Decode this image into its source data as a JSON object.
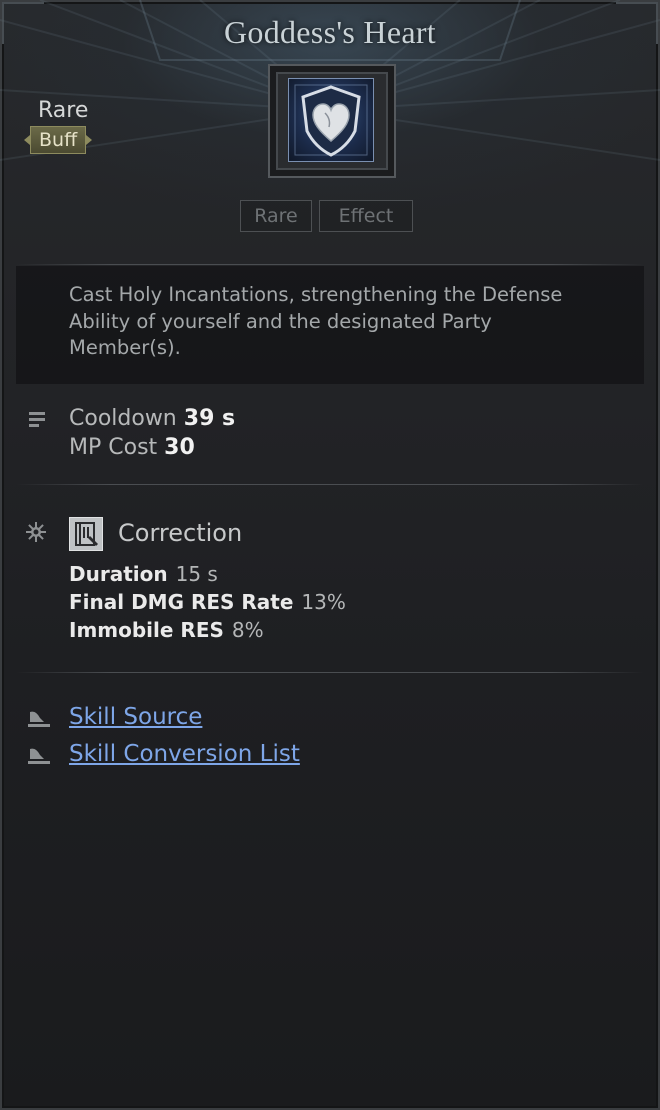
{
  "header": {
    "title": "Goddess's Heart",
    "rarity": "Rare",
    "type_badge": "Buff"
  },
  "tags": [
    "Rare",
    "Effect"
  ],
  "description": "Cast Holy Incantations, strengthening the Defense Ability of yourself and the designated Party Member(s).",
  "stats": {
    "cooldown_label": "Cooldown",
    "cooldown_value": "39 s",
    "mp_label": "MP Cost",
    "mp_value": "30"
  },
  "correction": {
    "title": "Correction",
    "lines": [
      {
        "label": "Duration",
        "value": "15 s"
      },
      {
        "label": "Final DMG RES Rate",
        "value": "13%"
      },
      {
        "label": "Immobile RES",
        "value": "8%"
      }
    ]
  },
  "links": [
    "Skill Source",
    "Skill Conversion List"
  ],
  "colors": {
    "link": "#7ea6e8",
    "badge": "#5b5a3c",
    "panel_bg": "#1e1f22"
  },
  "icons": {
    "skill": "heart-shield-icon",
    "stats": "list-icon",
    "correction_section": "gear-icon",
    "correction_badge": "spellbook-icon",
    "links": "quill-icon"
  }
}
